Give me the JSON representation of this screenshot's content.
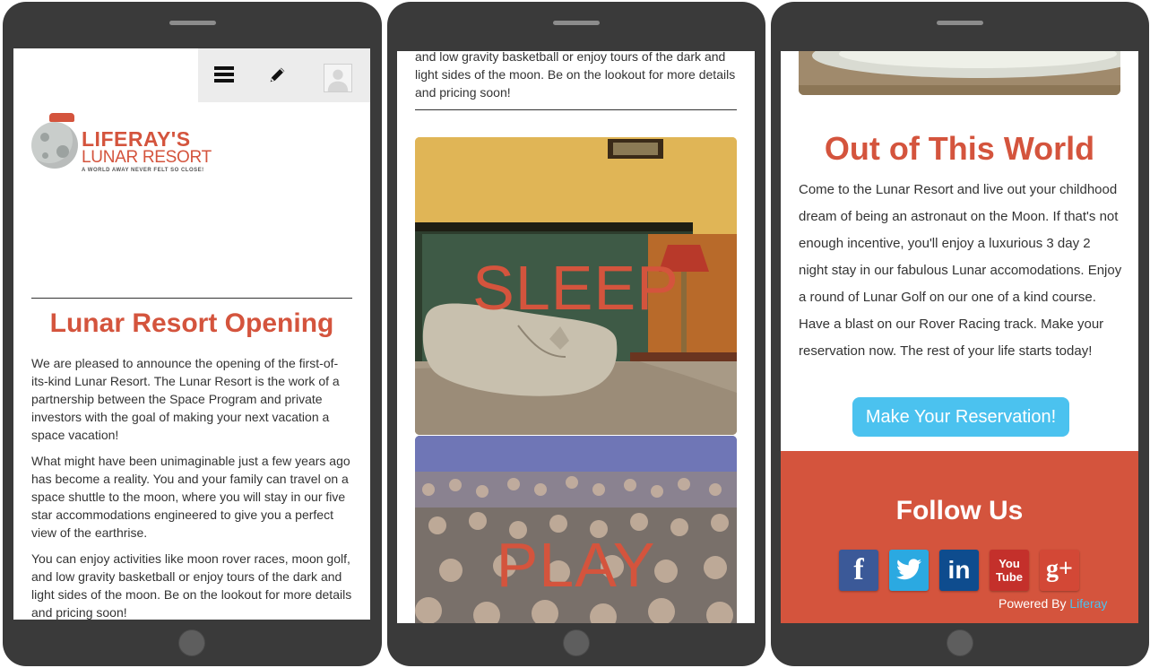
{
  "phone1": {
    "logo": {
      "name": "LIFERAY'S",
      "subtitle": "LUNAR RESORT",
      "tagline": "A WORLD AWAY NEVER FELT SO CLOSE!"
    },
    "title": "Lunar Resort Opening",
    "paragraphs": [
      "We are pleased to announce the opening of the first-of-its-kind Lunar Resort. The Lunar Resort is the work of a partnership between the Space Program and private investors with the goal of making your next vacation a space vacation!",
      "What might have been unimaginable just a few years ago has become a reality. You and your family can travel on a space shuttle to the moon, where you will stay in our five star accommodations engineered to give you a perfect view of the earthrise.",
      "You can enjoy activities like moon rover races, moon golf, and low gravity basketball or enjoy tours of the dark and light sides of the moon. Be on the lookout for more details and pricing soon!"
    ]
  },
  "phone2": {
    "top_text": "and low gravity basketball or enjoy tours of the dark and light sides of the moon. Be on the lookout for more details and pricing soon!",
    "sleep_label": "SLEEP",
    "play_label": "PLAY"
  },
  "phone3": {
    "title": "Out of This World",
    "body": "Come to the Lunar Resort and live out your childhood dream of being an astronaut on the Moon. If that's not enough incentive, you'll enjoy a luxurious 3 day 2 night stay in our fabulous Lunar accomodations. Enjoy a round of Lunar Golf on our one of a kind course. Have a blast on our Rover Racing track. Make your reservation now. The rest of your life starts today!",
    "cta_label": "Make Your Reservation!",
    "footer": {
      "heading": "Follow Us",
      "social": [
        {
          "name": "facebook",
          "glyph": "f",
          "color": "#3b5998"
        },
        {
          "name": "twitter",
          "glyph": "t",
          "color": "#2ba9e1"
        },
        {
          "name": "linkedin",
          "glyph": "in",
          "color": "#0e4c8e"
        },
        {
          "name": "youtube",
          "glyph": "You Tube",
          "color": "#c4302b"
        },
        {
          "name": "google-plus",
          "glyph": "g+",
          "color": "#d34836"
        }
      ],
      "powered_prefix": "Powered By",
      "powered_link": "Liferay"
    }
  },
  "colors": {
    "accent": "#d4543d",
    "cta": "#4bc2ef",
    "device": "#3a3a3a"
  }
}
